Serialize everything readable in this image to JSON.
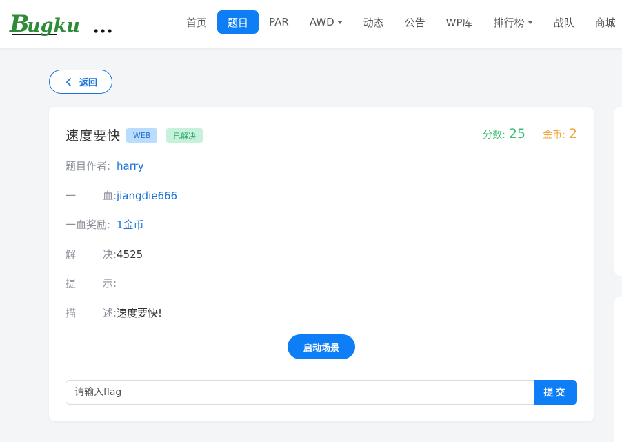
{
  "logo": {
    "text": "Bugku..."
  },
  "nav": {
    "items": [
      {
        "label": "首页",
        "active": false,
        "dropdown": false
      },
      {
        "label": "题目",
        "active": true,
        "dropdown": false
      },
      {
        "label": "PAR",
        "active": false,
        "dropdown": false
      },
      {
        "label": "AWD",
        "active": false,
        "dropdown": true
      },
      {
        "label": "动态",
        "active": false,
        "dropdown": false
      },
      {
        "label": "公告",
        "active": false,
        "dropdown": false
      },
      {
        "label": "WP库",
        "active": false,
        "dropdown": false
      },
      {
        "label": "排行榜",
        "active": false,
        "dropdown": true
      },
      {
        "label": "战队",
        "active": false,
        "dropdown": false
      },
      {
        "label": "商城",
        "active": false,
        "dropdown": false
      }
    ]
  },
  "back_button": {
    "label": "返回"
  },
  "challenge": {
    "title": "速度要快",
    "category_badge": "WEB",
    "status_badge": "已解决",
    "score_label": "分数:",
    "score_value": "25",
    "coin_label": "金币:",
    "coin_value": "2",
    "fields": {
      "author": {
        "label_chars": [
          "题目作者:"
        ],
        "value": "harry"
      },
      "first_blood": {
        "label_chars": [
          "一",
          "血:"
        ],
        "value": "jiangdie666"
      },
      "first_blood_reward": {
        "label_chars": [
          "一血奖励:"
        ],
        "value": "1金币"
      },
      "solves": {
        "label_chars": [
          "解",
          "决:"
        ],
        "value": "4525"
      },
      "hint": {
        "label_chars": [
          "提",
          "示:"
        ],
        "value": ""
      },
      "description": {
        "label_chars": [
          "描",
          "述:"
        ],
        "value": "速度要快!"
      }
    },
    "start_button": "启动场景",
    "flag_input": {
      "placeholder": "请输入flag",
      "value": ""
    },
    "submit_button": "提交"
  },
  "colors": {
    "primary": "#0d7ef5",
    "link": "#1a73d9",
    "score": "#3bbf73",
    "coin": "#f0a53b",
    "background": "#f4f5f7"
  }
}
